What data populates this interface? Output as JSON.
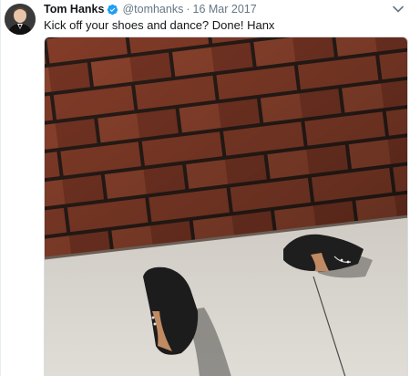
{
  "tweet": {
    "author_name": "Tom Hanks",
    "handle": "@tomhanks",
    "separator": "·",
    "date": "16 Mar 2017",
    "text": "Kick off your shoes and dance?  Done!  Hanx",
    "verified": true
  },
  "icons": {
    "verified": "verified-badge-icon",
    "caret": "chevron-down-icon"
  },
  "colors": {
    "name": "#14171a",
    "secondary": "#657786",
    "verified": "#1da1f2",
    "brick": "#8a3f2a",
    "mortar": "#2a1d18",
    "sidewalk": "#d6d3cd"
  },
  "media": {
    "type": "photo",
    "subject": ""
  }
}
